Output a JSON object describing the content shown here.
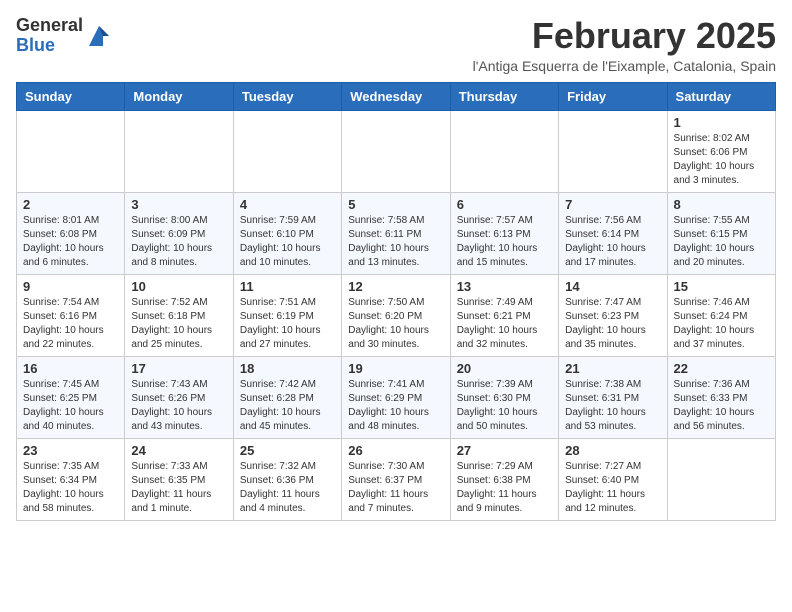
{
  "header": {
    "logo_general": "General",
    "logo_blue": "Blue",
    "title": "February 2025",
    "subtitle": "l'Antiga Esquerra de l'Eixample, Catalonia, Spain"
  },
  "weekdays": [
    "Sunday",
    "Monday",
    "Tuesday",
    "Wednesday",
    "Thursday",
    "Friday",
    "Saturday"
  ],
  "weeks": [
    [
      {
        "day": "",
        "info": ""
      },
      {
        "day": "",
        "info": ""
      },
      {
        "day": "",
        "info": ""
      },
      {
        "day": "",
        "info": ""
      },
      {
        "day": "",
        "info": ""
      },
      {
        "day": "",
        "info": ""
      },
      {
        "day": "1",
        "info": "Sunrise: 8:02 AM\nSunset: 6:06 PM\nDaylight: 10 hours and 3 minutes."
      }
    ],
    [
      {
        "day": "2",
        "info": "Sunrise: 8:01 AM\nSunset: 6:08 PM\nDaylight: 10 hours and 6 minutes."
      },
      {
        "day": "3",
        "info": "Sunrise: 8:00 AM\nSunset: 6:09 PM\nDaylight: 10 hours and 8 minutes."
      },
      {
        "day": "4",
        "info": "Sunrise: 7:59 AM\nSunset: 6:10 PM\nDaylight: 10 hours and 10 minutes."
      },
      {
        "day": "5",
        "info": "Sunrise: 7:58 AM\nSunset: 6:11 PM\nDaylight: 10 hours and 13 minutes."
      },
      {
        "day": "6",
        "info": "Sunrise: 7:57 AM\nSunset: 6:13 PM\nDaylight: 10 hours and 15 minutes."
      },
      {
        "day": "7",
        "info": "Sunrise: 7:56 AM\nSunset: 6:14 PM\nDaylight: 10 hours and 17 minutes."
      },
      {
        "day": "8",
        "info": "Sunrise: 7:55 AM\nSunset: 6:15 PM\nDaylight: 10 hours and 20 minutes."
      }
    ],
    [
      {
        "day": "9",
        "info": "Sunrise: 7:54 AM\nSunset: 6:16 PM\nDaylight: 10 hours and 22 minutes."
      },
      {
        "day": "10",
        "info": "Sunrise: 7:52 AM\nSunset: 6:18 PM\nDaylight: 10 hours and 25 minutes."
      },
      {
        "day": "11",
        "info": "Sunrise: 7:51 AM\nSunset: 6:19 PM\nDaylight: 10 hours and 27 minutes."
      },
      {
        "day": "12",
        "info": "Sunrise: 7:50 AM\nSunset: 6:20 PM\nDaylight: 10 hours and 30 minutes."
      },
      {
        "day": "13",
        "info": "Sunrise: 7:49 AM\nSunset: 6:21 PM\nDaylight: 10 hours and 32 minutes."
      },
      {
        "day": "14",
        "info": "Sunrise: 7:47 AM\nSunset: 6:23 PM\nDaylight: 10 hours and 35 minutes."
      },
      {
        "day": "15",
        "info": "Sunrise: 7:46 AM\nSunset: 6:24 PM\nDaylight: 10 hours and 37 minutes."
      }
    ],
    [
      {
        "day": "16",
        "info": "Sunrise: 7:45 AM\nSunset: 6:25 PM\nDaylight: 10 hours and 40 minutes."
      },
      {
        "day": "17",
        "info": "Sunrise: 7:43 AM\nSunset: 6:26 PM\nDaylight: 10 hours and 43 minutes."
      },
      {
        "day": "18",
        "info": "Sunrise: 7:42 AM\nSunset: 6:28 PM\nDaylight: 10 hours and 45 minutes."
      },
      {
        "day": "19",
        "info": "Sunrise: 7:41 AM\nSunset: 6:29 PM\nDaylight: 10 hours and 48 minutes."
      },
      {
        "day": "20",
        "info": "Sunrise: 7:39 AM\nSunset: 6:30 PM\nDaylight: 10 hours and 50 minutes."
      },
      {
        "day": "21",
        "info": "Sunrise: 7:38 AM\nSunset: 6:31 PM\nDaylight: 10 hours and 53 minutes."
      },
      {
        "day": "22",
        "info": "Sunrise: 7:36 AM\nSunset: 6:33 PM\nDaylight: 10 hours and 56 minutes."
      }
    ],
    [
      {
        "day": "23",
        "info": "Sunrise: 7:35 AM\nSunset: 6:34 PM\nDaylight: 10 hours and 58 minutes."
      },
      {
        "day": "24",
        "info": "Sunrise: 7:33 AM\nSunset: 6:35 PM\nDaylight: 11 hours and 1 minute."
      },
      {
        "day": "25",
        "info": "Sunrise: 7:32 AM\nSunset: 6:36 PM\nDaylight: 11 hours and 4 minutes."
      },
      {
        "day": "26",
        "info": "Sunrise: 7:30 AM\nSunset: 6:37 PM\nDaylight: 11 hours and 7 minutes."
      },
      {
        "day": "27",
        "info": "Sunrise: 7:29 AM\nSunset: 6:38 PM\nDaylight: 11 hours and 9 minutes."
      },
      {
        "day": "28",
        "info": "Sunrise: 7:27 AM\nSunset: 6:40 PM\nDaylight: 11 hours and 12 minutes."
      },
      {
        "day": "",
        "info": ""
      }
    ]
  ]
}
